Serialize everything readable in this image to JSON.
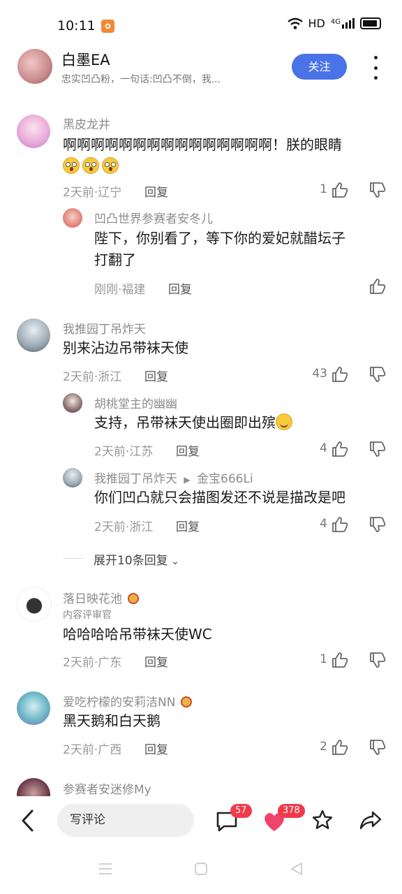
{
  "status": {
    "time": "10:11",
    "app_icon": "app-notification-icon",
    "network": "HD",
    "signal_label": "4G"
  },
  "header": {
    "username": "白墨EA",
    "description": "忠实凹凸粉，一句话:凹凸不倒，我...",
    "follow_label": "关注"
  },
  "comments": [
    {
      "user": "黑皮龙井",
      "text": "啊啊啊啊啊啊啊啊啊啊啊啊啊啊啊！朕的眼睛",
      "time_loc": "2天前·辽宁",
      "reply": "回复",
      "likes": "1",
      "replies": [
        {
          "user": "凹凸世界参赛者安冬儿",
          "text_line1": "陛下，你别看了，等下你的爱妃就醋坛子",
          "text_line2": "打翻了",
          "time_loc": "刚刚·福建",
          "reply": "回复"
        }
      ]
    },
    {
      "user": "我推园丁吊炸天",
      "text": "别来沾边吊带袜天使",
      "time_loc": "2天前·浙江",
      "reply": "回复",
      "likes": "43",
      "replies": [
        {
          "user": "胡桃堂主的幽幽",
          "text": "支持，吊带袜天使出圈即出殡",
          "time_loc": "2天前·江苏",
          "reply": "回复",
          "likes": "4"
        },
        {
          "user": "我推园丁吊炸天",
          "reply_arrow": "▶",
          "reply_to": "金宝666Li",
          "text": "你们凹凸就只会描图发还不说是描改是吧",
          "time_loc": "2天前·浙江",
          "reply": "回复",
          "likes": "4"
        }
      ],
      "expand_label": "展开10条回复"
    },
    {
      "user": "落日映花池",
      "role": "内容评审官",
      "text": "哈哈哈哈吊带袜天使WC",
      "time_loc": "2天前·广东",
      "reply": "回复",
      "likes": "1"
    },
    {
      "user": "爱吃柠檬的安莉洁NN",
      "text": "黑天鹅和白天鹅",
      "time_loc": "2天前·广西",
      "reply": "回复",
      "likes": "2"
    },
    {
      "user": "参赛者安迷修My"
    }
  ],
  "bottom_bar": {
    "comment_placeholder": "写评论",
    "comment_count": "57",
    "like_count": "378"
  },
  "colors": {
    "accent": "#4a73e8",
    "badge": "#f03a4a",
    "heart": "#f0436a"
  }
}
